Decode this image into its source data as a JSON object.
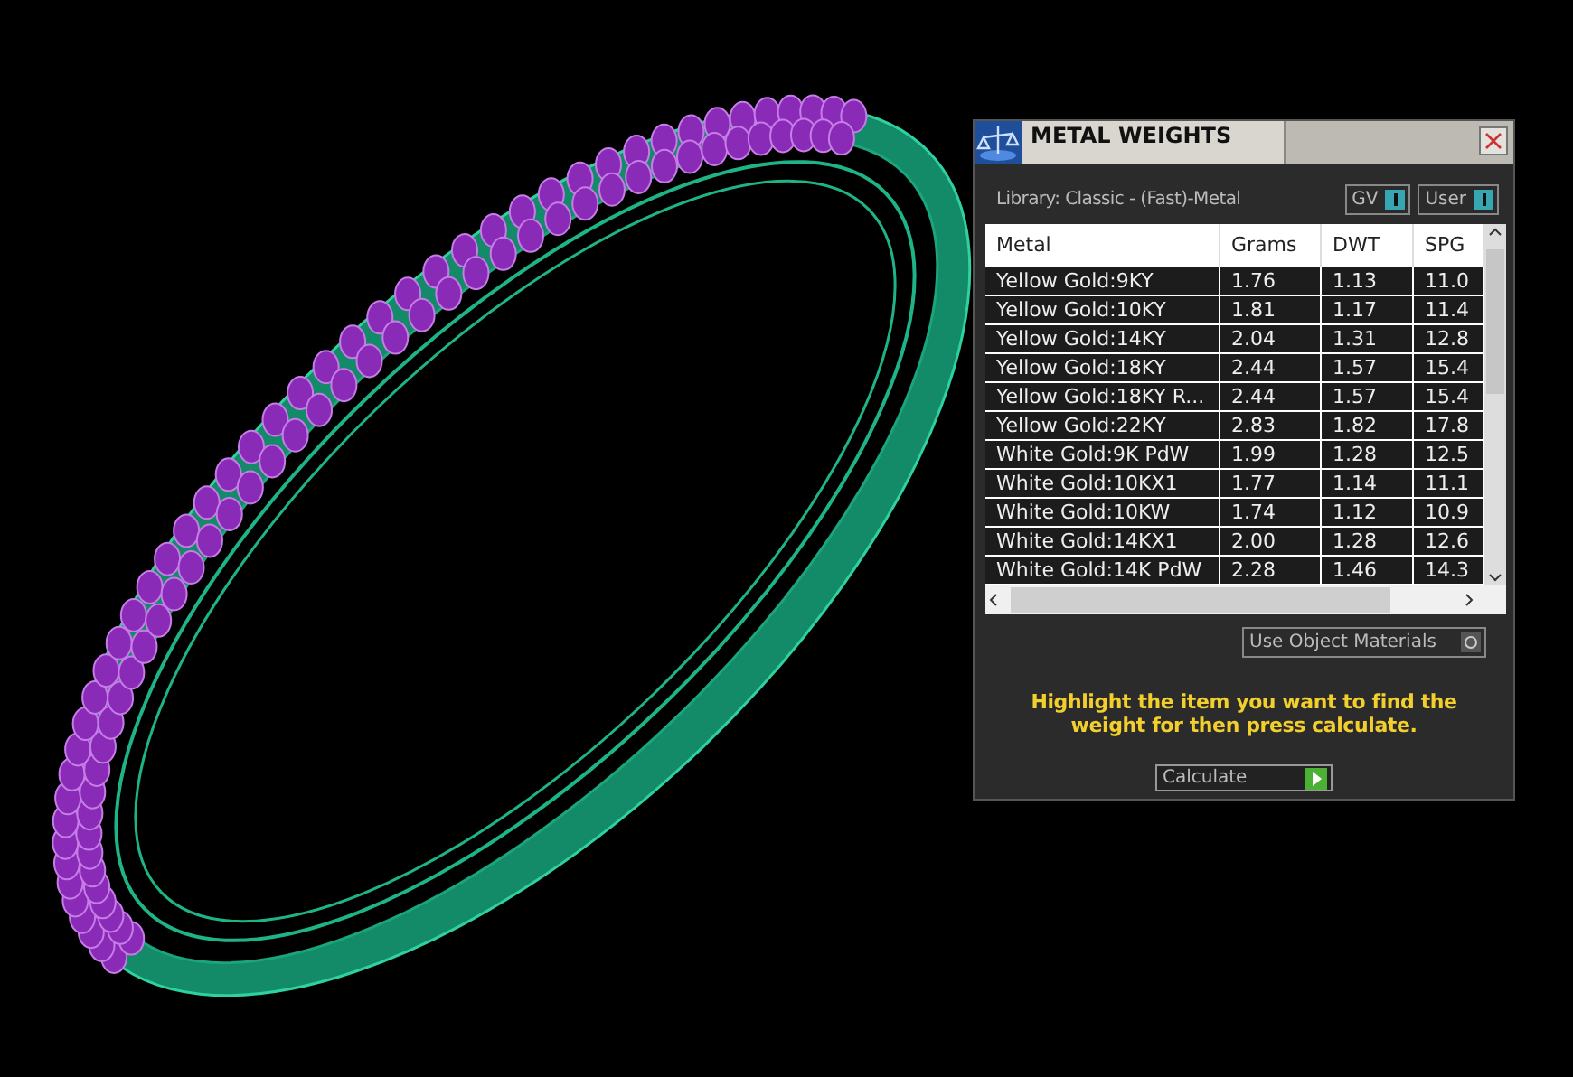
{
  "panel": {
    "title": "METAL WEIGHTS",
    "library": "Library: Classic - (Fast)-Metal",
    "toggles": [
      {
        "label": "GV",
        "on": true
      },
      {
        "label": "User",
        "on": true
      }
    ],
    "table": {
      "columns": [
        "Metal",
        "Grams",
        "DWT",
        "SPG"
      ],
      "rows": [
        [
          "Yellow Gold:9KY",
          "1.76",
          "1.13",
          "11.0"
        ],
        [
          "Yellow Gold:10KY",
          "1.81",
          "1.17",
          "11.4"
        ],
        [
          "Yellow Gold:14KY",
          "2.04",
          "1.31",
          "12.8"
        ],
        [
          "Yellow Gold:18KY",
          "2.44",
          "1.57",
          "15.4"
        ],
        [
          "Yellow Gold:18KY R...",
          "2.44",
          "1.57",
          "15.4"
        ],
        [
          "Yellow Gold:22KY",
          "2.83",
          "1.82",
          "17.8"
        ],
        [
          "White Gold:9K PdW",
          "1.99",
          "1.28",
          "12.5"
        ],
        [
          "White Gold:10KX1",
          "1.77",
          "1.14",
          "11.1"
        ],
        [
          "White Gold:10KW",
          "1.74",
          "1.12",
          "10.9"
        ],
        [
          "White Gold:14KX1",
          "2.00",
          "1.28",
          "12.6"
        ],
        [
          "White Gold:14K PdW",
          "2.28",
          "1.46",
          "14.3"
        ]
      ]
    },
    "material_toggle": {
      "label": "Use Object Materials",
      "on": false
    },
    "hint": "Highlight the item you want to find the weight for then press calculate.",
    "button": "Calculate"
  }
}
